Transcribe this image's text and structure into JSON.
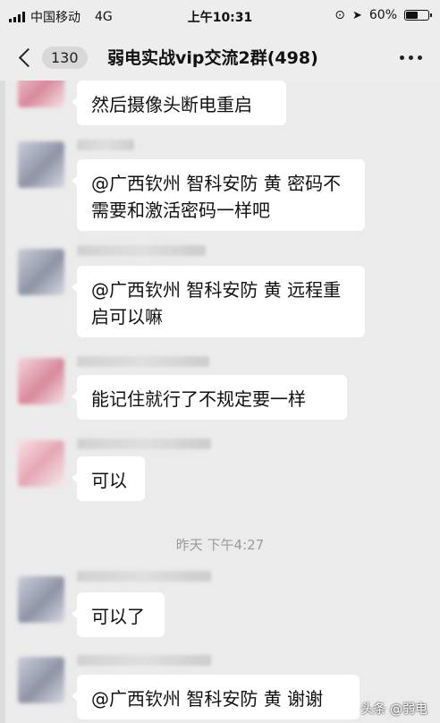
{
  "status_bar": {
    "carrier": "中国移动",
    "network": "4G",
    "time": "上午10:31",
    "battery_percent_text": "60%",
    "battery_level": 0.6
  },
  "nav": {
    "unread_count": "130",
    "title": "弱电实战vip交流2群(498)"
  },
  "messages": [
    {
      "text": "然后摄像头断电重启"
    },
    {
      "text": "@广西钦州 智科安防 黄 密码不需要和激活密码一样吧"
    },
    {
      "text": "@广西钦州 智科安防 黄 远程重启可以嘛"
    },
    {
      "text": "能记住就行了不规定要一样"
    },
    {
      "text": "可以"
    },
    {
      "text": "可以了"
    },
    {
      "text": "@广西钦州 智科安防 黄 谢谢"
    }
  ],
  "timestamp": "昨天 下午4:27",
  "watermark": "头条 @弱电"
}
